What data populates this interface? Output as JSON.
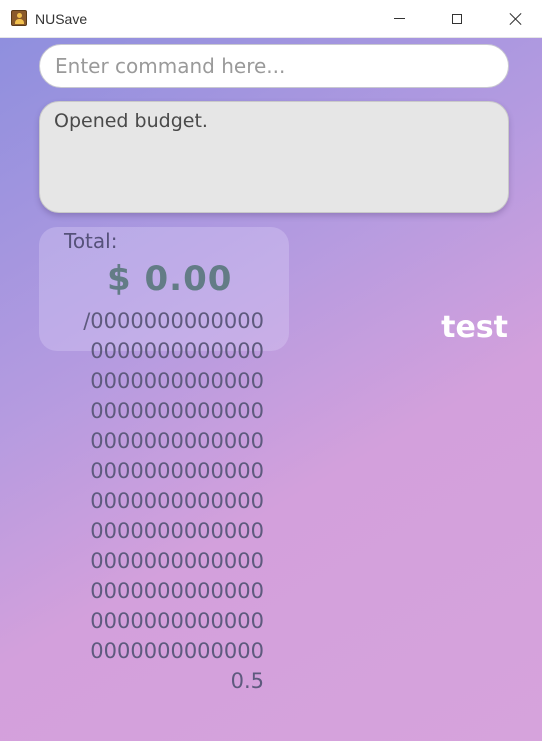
{
  "window": {
    "title": "NUSave"
  },
  "command": {
    "placeholder": "Enter command here...",
    "value": ""
  },
  "result": {
    "text": "Opened budget."
  },
  "total": {
    "label": "Total:",
    "amount": "$ 0.00",
    "limit_lines": [
      "/0000000000000",
      "0000000000000",
      "0000000000000",
      "0000000000000",
      "0000000000000",
      "0000000000000",
      "0000000000000",
      "0000000000000",
      "0000000000000",
      "0000000000000",
      "0000000000000",
      "0000000000000",
      "0.5"
    ]
  },
  "budget": {
    "name": "test"
  },
  "colors": {
    "gradient_start": "#8f8fde",
    "gradient_end": "#d6a3dc",
    "amount": "#637c86",
    "budget_name": "#ffffff"
  },
  "icons": {
    "app": "app-person-icon",
    "minimize": "minimize-icon",
    "maximize": "maximize-icon",
    "close": "close-icon"
  }
}
